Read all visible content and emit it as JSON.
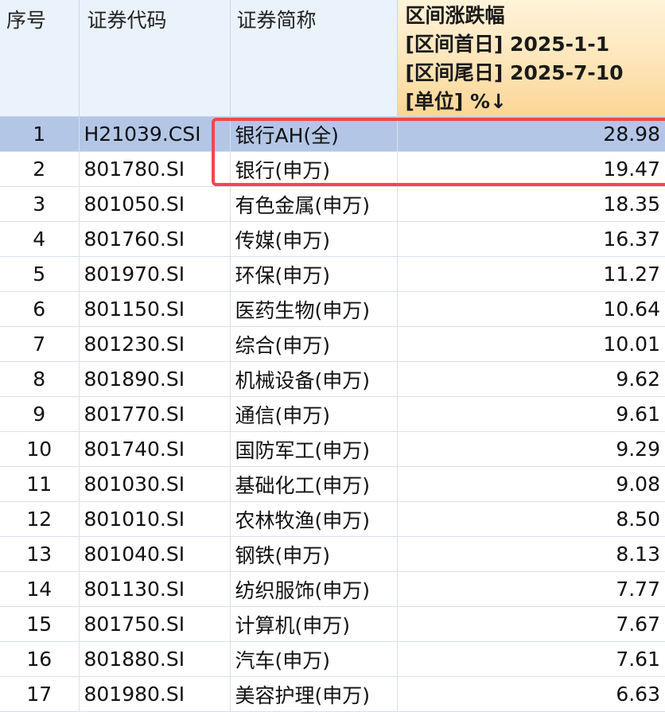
{
  "table": {
    "headers": {
      "index": "序号",
      "code": "证券代码",
      "name": "证券简称",
      "value_lines": [
        "区间涨跌幅",
        "[区间首日] 2025-1-1",
        "[区间尾日] 2025-7-10",
        "[单位] %↓"
      ]
    },
    "selected_row": 1,
    "rows": [
      {
        "idx": "1",
        "code": "H21039.CSI",
        "name": "银行AH(全)",
        "value": "28.98"
      },
      {
        "idx": "2",
        "code": "801780.SI",
        "name": "银行(申万)",
        "value": "19.47"
      },
      {
        "idx": "3",
        "code": "801050.SI",
        "name": "有色金属(申万)",
        "value": "18.35"
      },
      {
        "idx": "4",
        "code": "801760.SI",
        "name": "传媒(申万)",
        "value": "16.37"
      },
      {
        "idx": "5",
        "code": "801970.SI",
        "name": "环保(申万)",
        "value": "11.27"
      },
      {
        "idx": "6",
        "code": "801150.SI",
        "name": "医药生物(申万)",
        "value": "10.64"
      },
      {
        "idx": "7",
        "code": "801230.SI",
        "name": "综合(申万)",
        "value": "10.01"
      },
      {
        "idx": "8",
        "code": "801890.SI",
        "name": "机械设备(申万)",
        "value": "9.62"
      },
      {
        "idx": "9",
        "code": "801770.SI",
        "name": "通信(申万)",
        "value": "9.61"
      },
      {
        "idx": "10",
        "code": "801740.SI",
        "name": "国防军工(申万)",
        "value": "9.29"
      },
      {
        "idx": "11",
        "code": "801030.SI",
        "name": "基础化工(申万)",
        "value": "9.08"
      },
      {
        "idx": "12",
        "code": "801010.SI",
        "name": "农林牧渔(申万)",
        "value": "8.50"
      },
      {
        "idx": "13",
        "code": "801040.SI",
        "name": "钢铁(申万)",
        "value": "8.13"
      },
      {
        "idx": "14",
        "code": "801130.SI",
        "name": "纺织服饰(申万)",
        "value": "7.77"
      },
      {
        "idx": "15",
        "code": "801750.SI",
        "name": "计算机(申万)",
        "value": "7.67"
      },
      {
        "idx": "16",
        "code": "801880.SI",
        "name": "汽车(申万)",
        "value": "7.61"
      },
      {
        "idx": "17",
        "code": "801980.SI",
        "name": "美容护理(申万)",
        "value": "6.63"
      }
    ]
  },
  "colors": {
    "header_bg": "#eaf2fb",
    "sorted_header_bg": "#fde5b8",
    "selected_row_bg": "#b3c6e6",
    "highlight_box": "#f0484e"
  }
}
